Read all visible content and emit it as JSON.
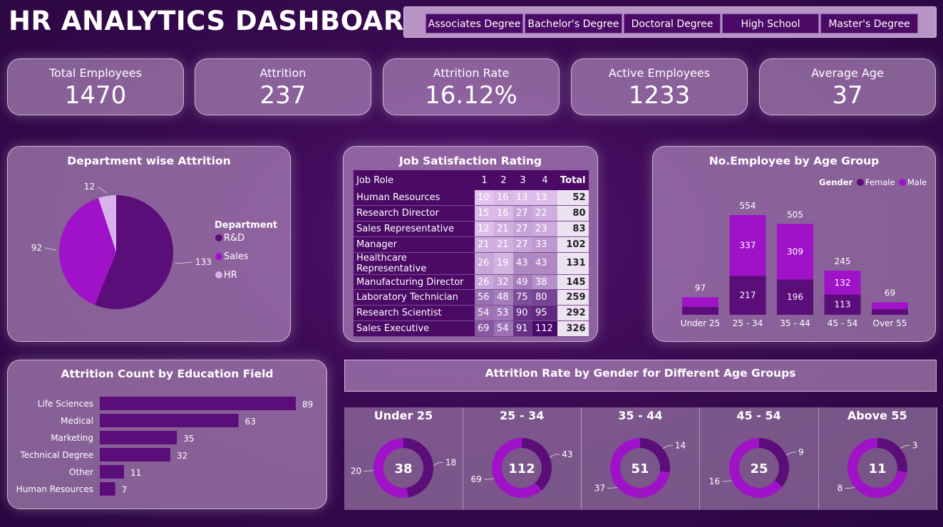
{
  "title": "HR ANALYTICS DASHBOARD",
  "slicer": [
    "Associates Degree",
    "Bachelor's Degree",
    "Doctoral Degree",
    "High School",
    "Master's Degree"
  ],
  "kpis": [
    {
      "label": "Total Employees",
      "value": "1470"
    },
    {
      "label": "Attrition",
      "value": "237"
    },
    {
      "label": "Attrition Rate",
      "value": "16.12%"
    },
    {
      "label": "Active Employees",
      "value": "1233"
    },
    {
      "label": "Average Age",
      "value": "37"
    }
  ],
  "colors": {
    "dark": "#5b0d7a",
    "bright": "#a012c8",
    "light": "#d8b2ec"
  },
  "dept": {
    "title": "Department wise Attrition",
    "legend_title": "Department",
    "chart_data": {
      "type": "pie",
      "labels": [
        "R&D",
        "Sales",
        "HR"
      ],
      "values": [
        133,
        92,
        12
      ]
    }
  },
  "job": {
    "title": "Job Satisfaction Rating",
    "headers": [
      "Job Role",
      "1",
      "2",
      "3",
      "4",
      "Total"
    ],
    "rows": [
      [
        "Human Resources",
        "10",
        "16",
        "13",
        "13",
        "52"
      ],
      [
        "Research Director",
        "15",
        "16",
        "27",
        "22",
        "80"
      ],
      [
        "Sales Representative",
        "12",
        "21",
        "27",
        "23",
        "83"
      ],
      [
        "Manager",
        "21",
        "21",
        "27",
        "33",
        "102"
      ],
      [
        "Healthcare Representative",
        "26",
        "19",
        "43",
        "43",
        "131"
      ],
      [
        "Manufacturing Director",
        "26",
        "32",
        "49",
        "38",
        "145"
      ],
      [
        "Laboratory Technician",
        "56",
        "48",
        "75",
        "80",
        "259"
      ],
      [
        "Research Scientist",
        "54",
        "53",
        "90",
        "95",
        "292"
      ],
      [
        "Sales Executive",
        "69",
        "54",
        "91",
        "112",
        "326"
      ]
    ]
  },
  "age": {
    "title": "No.Employee by Age Group",
    "legend_title": "Gender",
    "chart_data": {
      "type": "bar",
      "categories": [
        "Under 25",
        "25 - 34",
        "35 - 44",
        "45 - 54",
        "Over 55"
      ],
      "series": [
        {
          "name": "Female",
          "values": [
            null,
            217,
            196,
            113,
            null
          ]
        },
        {
          "name": "Male",
          "values": [
            null,
            337,
            309,
            132,
            null
          ]
        }
      ],
      "totals": [
        97,
        554,
        505,
        245,
        69
      ]
    }
  },
  "edu": {
    "title": "Attrition Count by Education Field",
    "chart_data": {
      "type": "bar",
      "categories": [
        "Life Sciences",
        "Medical",
        "Marketing",
        "Technical Degree",
        "Other",
        "Human Resources"
      ],
      "values": [
        89,
        63,
        35,
        32,
        11,
        7
      ]
    }
  },
  "gender": {
    "title": "Attrition Rate by Gender for Different Age Groups",
    "chart_data": [
      {
        "type": "pie",
        "title": "Under 25",
        "center": "38",
        "values": [
          18,
          20
        ]
      },
      {
        "type": "pie",
        "title": "25 - 34",
        "center": "112",
        "values": [
          43,
          69
        ]
      },
      {
        "type": "pie",
        "title": "35 - 44",
        "center": "51",
        "values": [
          14,
          37
        ]
      },
      {
        "type": "pie",
        "title": "45 - 54",
        "center": "25",
        "values": [
          9,
          16
        ]
      },
      {
        "type": "pie",
        "title": "Above 55",
        "center": "11",
        "values": [
          3,
          8
        ]
      }
    ]
  }
}
